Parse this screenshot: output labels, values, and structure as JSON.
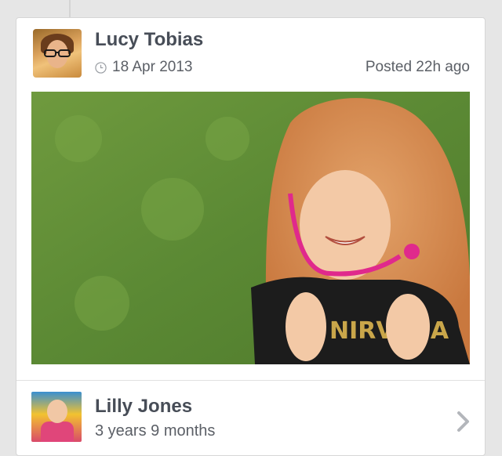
{
  "post": {
    "author_name": "Lucy Tobias",
    "date": "18 Apr 2013",
    "posted_label": "Posted 22h ago",
    "date_icon": "clock-icon"
  },
  "child": {
    "name": "Lilly Jones",
    "age": "3 years 9 months",
    "nav_icon": "chevron-right-icon"
  },
  "colors": {
    "background": "#e6e6e6",
    "card": "#ffffff",
    "name_text": "#474d57",
    "meta_text": "#5b5f66",
    "chevron": "#b3b6bb"
  }
}
